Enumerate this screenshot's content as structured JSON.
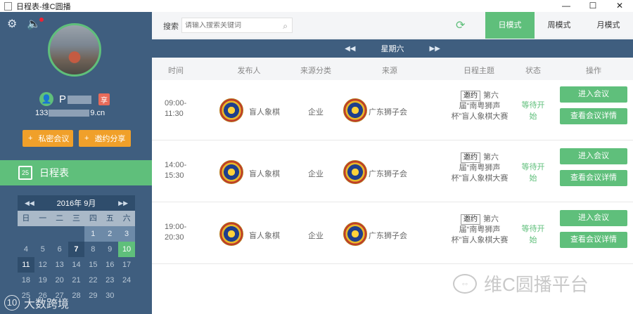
{
  "window": {
    "title": "日程表-维C圆播",
    "buttons": [
      "—",
      "☐",
      "✕"
    ]
  },
  "sidebar": {
    "user": {
      "name_visible": "P",
      "badge": "享",
      "email_prefix": "133",
      "email_suffix": "9.cn"
    },
    "buttons": {
      "private_meeting": "私密会议",
      "invite_share": "邀约分享",
      "plus": "+"
    },
    "section_title": "日程表",
    "calendar_icon_text": "25",
    "calendar": {
      "month_label": "2016年 9月",
      "prev": "◀◀",
      "next": "▶▶",
      "weekdays": [
        "日",
        "一",
        "二",
        "三",
        "四",
        "五",
        "六"
      ],
      "rows": [
        [
          "",
          "",
          "",
          "",
          "1",
          "2",
          "3"
        ],
        [
          "4",
          "5",
          "6",
          "7",
          "8",
          "9",
          "10"
        ],
        [
          "11",
          "12",
          "13",
          "14",
          "15",
          "16",
          "17"
        ],
        [
          "18",
          "19",
          "20",
          "21",
          "22",
          "23",
          "24"
        ],
        [
          "25",
          "26",
          "27",
          "28",
          "29",
          "30",
          ""
        ]
      ],
      "selected": "10",
      "bold": "7"
    },
    "watermark": "大数跨境",
    "watermark_logo": "10"
  },
  "toolbar": {
    "search_label": "搜索",
    "search_placeholder": "请输入搜索关键词",
    "modes": [
      "日模式",
      "周模式",
      "月模式"
    ],
    "active_mode": "日模式"
  },
  "day_nav": {
    "label": "星期六",
    "prev": "◀◀",
    "next": "▶▶"
  },
  "columns": [
    "时间",
    "发布人",
    "来源分类",
    "来源",
    "日程主题",
    "状态",
    "操作"
  ],
  "rows": [
    {
      "time_start": "09:00-",
      "time_end": "11:30",
      "publisher": "盲人象棋",
      "category": "企业",
      "source": "广东狮子会",
      "tag": "邀约",
      "topic_line1": "第六",
      "topic_line2": "届“南粤狮声",
      "topic_line3": "杯”盲人象棋大赛",
      "status_line1": "等待开",
      "status_line2": "始",
      "enter_label": "进入会议",
      "detail_label": "查看会议详情"
    },
    {
      "time_start": "14:00-",
      "time_end": "15:30",
      "publisher": "盲人象棋",
      "category": "企业",
      "source": "广东狮子会",
      "tag": "邀约",
      "topic_line1": "第六",
      "topic_line2": "届“南粤狮声",
      "topic_line3": "杯”盲人象棋大赛",
      "status_line1": "等待开",
      "status_line2": "始",
      "enter_label": "进入会议",
      "detail_label": "查看会议详情"
    },
    {
      "time_start": "19:00-",
      "time_end": "20:30",
      "publisher": "盲人象棋",
      "category": "企业",
      "source": "广东狮子会",
      "tag": "邀约",
      "topic_line1": "第六",
      "topic_line2": "届“南粤狮声",
      "topic_line3": "杯”盲人象棋大赛",
      "status_line1": "等待开",
      "status_line2": "始",
      "enter_label": "进入会议",
      "detail_label": "查看会议详情"
    }
  ],
  "watermark": "维C圆播平台",
  "colors": {
    "sidebar": "#3f5e7f",
    "accent_green": "#5fbf7b",
    "accent_orange": "#f0a02a",
    "header_bar": "#3f5e7f"
  },
  "icons": [
    "settings-icon",
    "speaker-icon",
    "user-icon",
    "calendar-icon",
    "search-icon",
    "refresh-icon",
    "lions-club-logo",
    "wechat-icon"
  ]
}
